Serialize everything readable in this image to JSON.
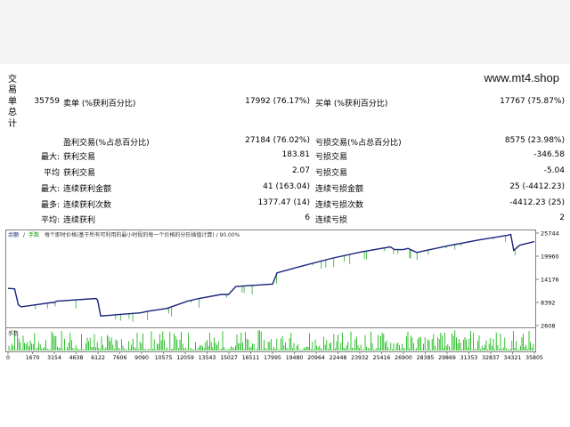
{
  "brand": "www.mt4.shop",
  "vertical_label": [
    "交",
    "易",
    "单",
    "总",
    "计"
  ],
  "stats": {
    "total_trades": "35759",
    "short_label": "卖单 (%获利百分比)",
    "short_value": "17992 (76.17%)",
    "long_label": "买单 (%获利百分比)",
    "long_value": "17767 (75.87%)",
    "profit_trades_label": "盈利交易(%占总百分比)",
    "profit_trades_value": "27184 (76.02%)",
    "loss_trades_label": "亏损交易(%占总百分比)",
    "loss_trades_value": "8575 (23.98%)",
    "rows": [
      {
        "prefix": "最大:",
        "l_label": "获利交易",
        "l_value": "183.81",
        "r_label": "亏损交易",
        "r_value": "-346.58"
      },
      {
        "prefix": "平均",
        "l_label": "获利交易",
        "l_value": "2.07",
        "r_label": "亏损交易",
        "r_value": "-5.04"
      },
      {
        "prefix": "最大:",
        "l_label": "连续获利金额",
        "l_value": "41 (163.04)",
        "r_label": "连续亏损金额",
        "r_value": "25 (-4412.23)"
      },
      {
        "prefix": "最多:",
        "l_label": "连续获利次数",
        "l_value": "1377.47 (14)",
        "r_label": "连续亏损次数",
        "r_value": "-4412.23 (25)"
      },
      {
        "prefix": "平均:",
        "l_label": "连续获利",
        "l_value": "6",
        "r_label": "连续亏损",
        "r_value": "2"
      }
    ]
  },
  "chart": {
    "legend_balance": "余额",
    "legend_lots": "手数",
    "description": "每个即时价格(基于所有可利用的最小时段的每一个价格的分形插值计算) / 90.00%",
    "volume_label": "手数",
    "line_color": "#1a237e",
    "dip_color": "#33aa33",
    "volume_color": "#00b000",
    "axis_color": "#808080"
  },
  "chart_data": {
    "type": "line",
    "x_ticks": [
      "0",
      "1670",
      "3154",
      "4638",
      "6122",
      "7606",
      "9090",
      "10575",
      "12059",
      "13543",
      "15027",
      "16511",
      "17995",
      "19480",
      "20964",
      "22448",
      "23932",
      "25416",
      "26900",
      "28385",
      "29869",
      "31353",
      "32837",
      "34321",
      "35805"
    ],
    "y_ticks": [
      "25744",
      "19960",
      "14176",
      "8392",
      "2608"
    ],
    "ylim": [
      2608,
      25744
    ],
    "xlim": [
      0,
      35805
    ],
    "series": [
      {
        "x": [
          0,
          450,
          700,
          900,
          3000,
          3100,
          3300,
          6000,
          6100,
          6300,
          9000,
          9500,
          10800,
          11500,
          12200,
          13000,
          14500,
          15000,
          15500,
          18000,
          18300,
          20000,
          22000,
          24000,
          26000,
          26300,
          26900,
          27200,
          27800,
          30000,
          32000,
          34000,
          34200,
          34400,
          34800,
          35805
        ],
        "y": [
          11900,
          11800,
          7800,
          7300,
          8400,
          8300,
          8700,
          9400,
          8900,
          5000,
          5800,
          6200,
          6900,
          7800,
          8700,
          9400,
          10400,
          10400,
          12400,
          13000,
          15800,
          17500,
          19400,
          21000,
          22300,
          21600,
          21600,
          21900,
          20900,
          22600,
          24000,
          25200,
          25400,
          21400,
          22700,
          23600
        ]
      }
    ],
    "volume_ylim": [
      0,
      12
    ]
  }
}
